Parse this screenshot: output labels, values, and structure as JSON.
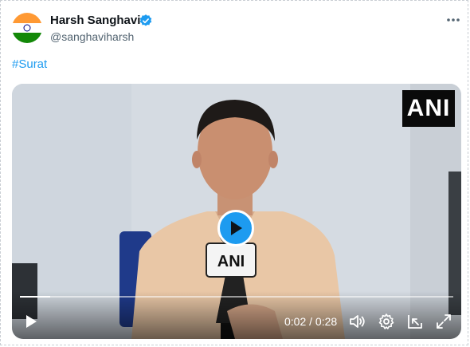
{
  "author": {
    "name": "Harsh Sanghavi",
    "handle": "@sanghaviharsh",
    "avatar_colors": [
      "#ff9933",
      "#ffffff",
      "#138808"
    ]
  },
  "post": {
    "hashtag": "#Surat"
  },
  "video": {
    "watermark": "ANI",
    "mic_label": "ANI",
    "time_current": "0:02",
    "time_separator": "/",
    "time_total": "0:28",
    "progress_fraction": 0.07
  },
  "colors": {
    "accent": "#1d9bf0",
    "text": "#0f1419",
    "muted": "#536471"
  },
  "icons": {
    "more": "more-dots-icon",
    "play": "play-icon",
    "volume": "volume-icon",
    "settings": "gear-icon",
    "dock": "dock-icon",
    "fullscreen": "fullscreen-icon"
  }
}
